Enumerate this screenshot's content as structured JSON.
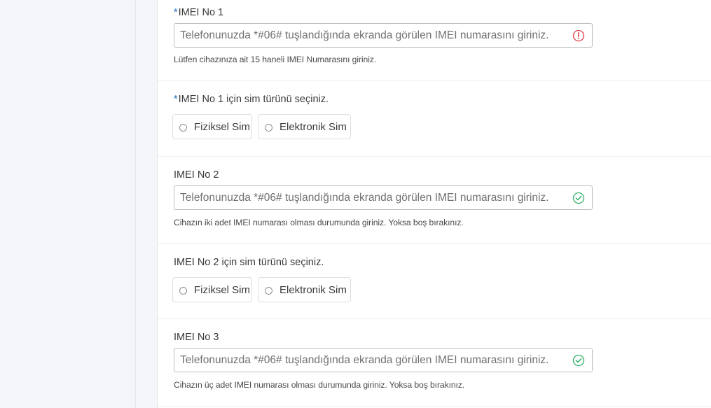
{
  "imei1": {
    "required_mark": "*",
    "label": "IMEI No 1",
    "placeholder": "Telefonunuzda *#06# tuşlandığında ekranda görülen IMEI numarasını giriniz.",
    "value": "",
    "status": "error",
    "help": "Lütfen cihazınıza ait 15 haneli IMEI Numarasını giriniz."
  },
  "sim1": {
    "required_mark": "*",
    "label": "IMEI No 1 için sim türünü seçiniz.",
    "options": [
      "Fiziksel Sim",
      "Elektronik Sim"
    ]
  },
  "imei2": {
    "label": "IMEI No 2",
    "placeholder": "Telefonunuzda *#06# tuşlandığında ekranda görülen IMEI numarasını giriniz.",
    "value": "",
    "status": "valid",
    "help": "Cihazın iki adet IMEI numarası olması durumunda giriniz. Yoksa boş bırakınız."
  },
  "sim2": {
    "label": "IMEI No 2 için sim türünü seçiniz.",
    "options": [
      "Fiziksel Sim",
      "Elektronik Sim"
    ]
  },
  "imei3": {
    "label": "IMEI No 3",
    "placeholder": "Telefonunuzda *#06# tuşlandığında ekranda görülen IMEI numarasını giriniz.",
    "value": "",
    "status": "valid",
    "help": "Cihazın üç adet IMEI numarası olması durumunda giriniz. Yoksa boş bırakınız."
  },
  "colors": {
    "required": "#1a6dc0",
    "error": "#e0424b",
    "valid": "#2fb36a"
  }
}
